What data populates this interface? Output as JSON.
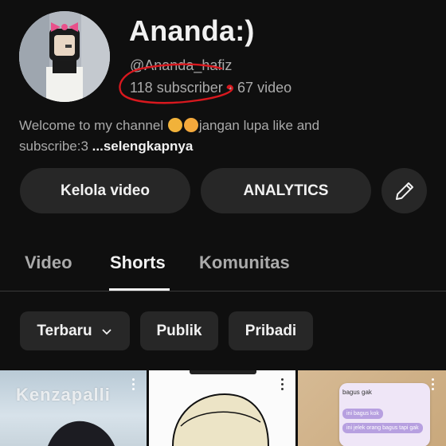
{
  "channel": {
    "name": "Ananda:)",
    "handle": "@Ananda_hafiz",
    "subscribers": "118 subscriber",
    "videos": "67 video",
    "separator": "•",
    "description": "Welcome to my channel 🥰🥳jangan lupa like and subscribe:3",
    "description_part1": "Welcome to my channel ",
    "description_part2": "jangan lupa like and subscribe:3",
    "more_label": "...selengkapnya"
  },
  "actions": {
    "manage_label": "Kelola video",
    "analytics_label": "ANALYTICS",
    "edit_icon": "pencil-icon"
  },
  "tabs": [
    {
      "label": "Video",
      "active": false
    },
    {
      "label": "Shorts",
      "active": true
    },
    {
      "label": "Komunitas",
      "active": false
    }
  ],
  "filters": {
    "sort_label": "Terbaru",
    "public_label": "Publik",
    "private_label": "Pribadi"
  },
  "thumbnails": [
    {
      "overlay_text": "Kenzapalli"
    },
    {
      "overlay_text": ""
    },
    {
      "title": "bagus gak",
      "bubbles": [
        "ini bagus kok",
        "ini jelek orang bagus tapi gak"
      ]
    }
  ],
  "colors": {
    "background": "#0f0f0f",
    "pill": "#272727",
    "text_primary": "#f1f1f1",
    "text_secondary": "#aaaaaa",
    "annotation_red": "#d8181e"
  }
}
